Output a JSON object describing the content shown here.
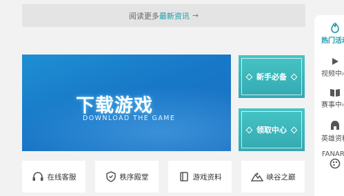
{
  "more_bar": {
    "prefix": "阅读更多",
    "accent": "最新资讯",
    "arrow": "→"
  },
  "download": {
    "title": "下载游戏",
    "subtitle": "DOWNLOAD THE GAME"
  },
  "side_buttons": [
    {
      "label": "新手必备"
    },
    {
      "label": "领取中心"
    }
  ],
  "tiles": [
    {
      "label": "在线客服",
      "icon": "headset-icon"
    },
    {
      "label": "秩序殿堂",
      "icon": "shield-icon"
    },
    {
      "label": "游戏资料",
      "icon": "book-icon"
    },
    {
      "label": "峡谷之巅",
      "icon": "mountain-icon"
    }
  ],
  "right_nav": [
    {
      "label": "热门活动",
      "icon": "flame-icon",
      "active": true
    },
    {
      "label": "视频中心",
      "icon": "play-icon"
    },
    {
      "label": "赛事中心",
      "icon": "book-icon"
    },
    {
      "label": "英雄资料",
      "icon": "helmet-icon"
    },
    {
      "label": "FANART",
      "icon": "palette-icon"
    }
  ],
  "colors": {
    "accent": "#1a9aa8",
    "banner_blue": "#1e8fd3",
    "button_teal": "#3fb8bd"
  }
}
